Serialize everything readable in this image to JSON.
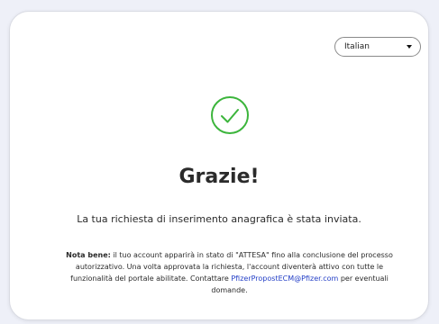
{
  "language_select": {
    "selected": "Italian"
  },
  "confirmation": {
    "title": "Grazie!",
    "subtitle": "La tua richiesta di inserimento anagrafica è stata inviata.",
    "note_label": "Nota bene:",
    "note_text": " il tuo account apparirà in stato di \"ATTESA\" fino alla conclusione del processo autorizzativo. Una volta approvata la richiesta, l'account diventerà attivo con tutte le funzionalità del portale abilitate.",
    "contact_prefix": "Contattare ",
    "contact_email": "PfizerPropostECM@Pfizer.com",
    "contact_suffix": " per eventuali domande."
  },
  "colors": {
    "success": "#3cb53c",
    "link": "#2540c7",
    "background": "#eef0f8"
  },
  "icons": {
    "success": "check-circle-icon",
    "dropdown": "caret-down-icon"
  }
}
